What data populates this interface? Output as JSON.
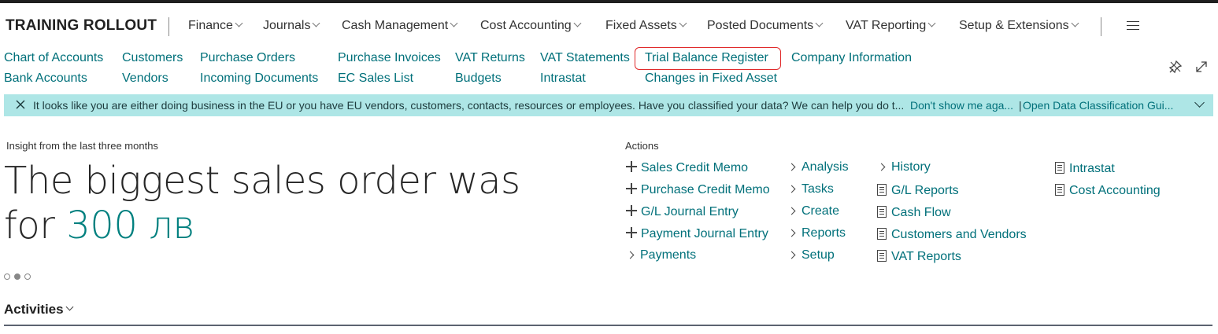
{
  "header": {
    "company": "TRAINING ROLLOUT",
    "menus": [
      "Finance",
      "Journals",
      "Cash Management",
      "Cost Accounting",
      "Fixed Assets",
      "Posted Documents",
      "VAT Reporting",
      "Setup & Extensions"
    ]
  },
  "quick_links": {
    "row1": [
      "Chart of Accounts",
      "Customers",
      "Purchase Orders",
      "Purchase Invoices",
      "VAT Returns",
      "VAT Statements",
      "Trial Balance Register",
      "Company Information"
    ],
    "row2": [
      "Bank Accounts",
      "Vendors",
      "Incoming Documents",
      "EC Sales List",
      "Budgets",
      "Intrastat",
      "Changes in Fixed Asset"
    ]
  },
  "notification": {
    "message": "It looks like you are either doing business in the EU or you have EU vendors, customers, contacts, resources or employees. Have you classified your data? We can help you do t...",
    "action1": "Don't show me aga...",
    "separator": "|",
    "action2": "Open Data Classification Gui..."
  },
  "insight": {
    "caption": "Insight from the last three months",
    "headline_line1": "The biggest sales order was",
    "headline_prefix": "for",
    "amount": "300 лв"
  },
  "actions": {
    "caption": "Actions",
    "col1": [
      "Sales Credit Memo",
      "Purchase Credit Memo",
      "G/L Journal Entry",
      "Payment Journal Entry",
      "Payments"
    ],
    "col2": [
      "Analysis",
      "Tasks",
      "Create",
      "Reports",
      "Setup"
    ],
    "col3": [
      "History",
      "G/L Reports",
      "Cash Flow",
      "Customers and Vendors",
      "VAT Reports"
    ],
    "col4": [
      "Intrastat",
      "Cost Accounting"
    ]
  },
  "activities": {
    "title": "Activities"
  },
  "colors": {
    "link": "#00707a",
    "notification_bg": "#aee6e6",
    "highlight": "#e0292a"
  }
}
